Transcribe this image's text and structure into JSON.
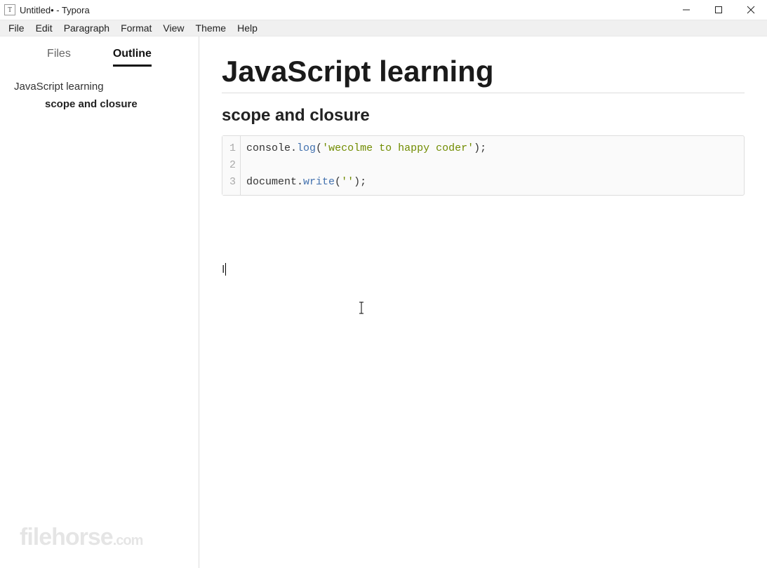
{
  "window": {
    "title": "Untitled• - Typora",
    "app_icon_letter": "T"
  },
  "menubar": {
    "items": [
      "File",
      "Edit",
      "Paragraph",
      "Format",
      "View",
      "Theme",
      "Help"
    ]
  },
  "sidebar": {
    "tabs": {
      "files": "Files",
      "outline": "Outline",
      "active": "outline"
    },
    "outline": {
      "h1": "JavaScript learning",
      "h2": "scope and closure"
    }
  },
  "document": {
    "h1": "JavaScript learning",
    "h2": "scope and closure",
    "code": {
      "lines": [
        {
          "n": "1",
          "segments": [
            {
              "t": "console",
              "c": "plain"
            },
            {
              "t": ".",
              "c": "plain"
            },
            {
              "t": "log",
              "c": "call"
            },
            {
              "t": "(",
              "c": "plain"
            },
            {
              "t": "'wecolme to happy coder'",
              "c": "str"
            },
            {
              "t": ");",
              "c": "plain"
            }
          ]
        },
        {
          "n": "2",
          "segments": []
        },
        {
          "n": "3",
          "segments": [
            {
              "t": "document",
              "c": "plain"
            },
            {
              "t": ".",
              "c": "plain"
            },
            {
              "t": "write",
              "c": "call"
            },
            {
              "t": "(",
              "c": "plain"
            },
            {
              "t": "''",
              "c": "str"
            },
            {
              "t": ");",
              "c": "plain"
            }
          ]
        }
      ]
    },
    "cursor_text": "I"
  },
  "watermark": {
    "main": "filehorse",
    "suffix": ".com"
  }
}
